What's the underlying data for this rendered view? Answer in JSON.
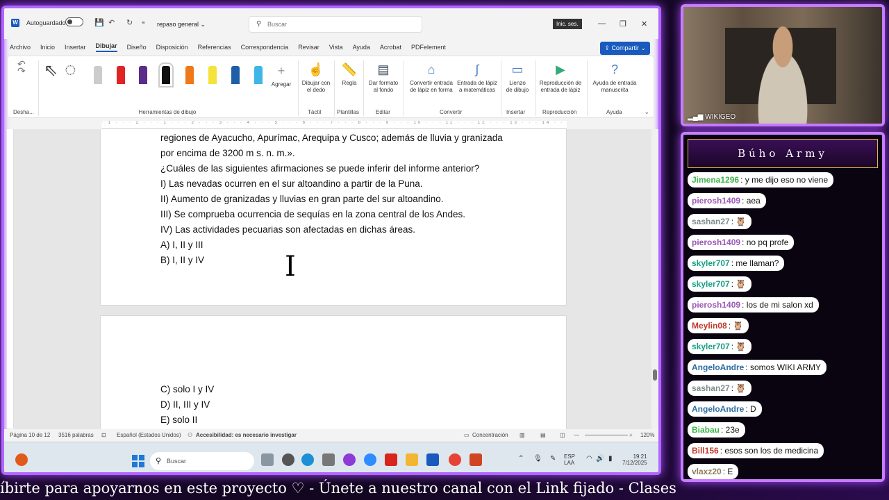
{
  "word": {
    "title_bar": {
      "app_icon": "W",
      "autosave_label": "Autoguardado",
      "doc_name": "repaso general",
      "search_placeholder": "Buscar",
      "signin_label": "Inic. ses."
    },
    "menu": [
      "Archivo",
      "Inicio",
      "Insertar",
      "Dibujar",
      "Diseño",
      "Disposición",
      "Referencias",
      "Correspondencia",
      "Revisar",
      "Vista",
      "Ayuda",
      "Acrobat",
      "PDFelement"
    ],
    "active_menu": "Dibujar",
    "share_label": "Compartir",
    "ribbon": {
      "undo_label": "Desha...",
      "group_drawing_tools": "Herramientas de dibujo",
      "add_label": "Agregar",
      "draw_finger_label": "Dibujar con\nel dedo",
      "group_tactil": "Táctil",
      "ruler_label": "Regla",
      "group_templates": "Plantillas",
      "format_bg_label": "Dar formato\nal fondo",
      "group_edit": "Editar",
      "convert_shape_label": "Convertir entrada\nde lápiz en forma",
      "math_label": "Entrada de lápiz\na matemáticas",
      "group_convert": "Convertir",
      "canvas_label": "Lienzo\nde dibujo",
      "group_insert": "Insertar",
      "replay_label": "Reproducción de\nentrada de lápiz",
      "group_replay": "Reproducción",
      "ink_help_label": "Ayuda de entrada\nmanuscrita",
      "group_help": "Ayuda"
    },
    "page1_lines": [
      "regiones de Ayacucho, Apurímac, Arequipa y Cusco; además de lluvia y granizada",
      "por encima de 3200 m s. n. m.».",
      "¿Cuáles de las siguientes afirmaciones se puede inferir del informe anterior?",
      "I) Las nevadas ocurren en el sur altoandino a partir de la Puna.",
      "II) Aumento de granizadas y lluvias en gran parte del sur altoandino.",
      "III) Se comprueba ocurrencia de sequías en la zona central de los Andes.",
      "IV) Las actividades pecuarias son afectadas en dichas áreas.",
      "A) I, II y III",
      "B) I, II y IV"
    ],
    "page2_lines": [
      "C) solo I y IV",
      "D) II, III y IV",
      "E) solo II"
    ],
    "status": {
      "page": "Página 10 de 12",
      "words": "3516 palabras",
      "language": "Español (Estados Unidos)",
      "accessibility": "Accesibilidad: es necesario investigar",
      "focus": "Concentración",
      "zoom": "120%"
    },
    "taskbar": {
      "search_placeholder": "Buscar",
      "lang_top": "ESP",
      "lang_bottom": "LAA",
      "time": "19:21",
      "date": "7/12/2025"
    }
  },
  "webcam": {
    "label": "WIKIGEO"
  },
  "chat": {
    "title": "Búho Army",
    "messages": [
      {
        "user": "Jimena1296",
        "color": "#3bb54a",
        "text": ": y me dijo eso no viene"
      },
      {
        "user": "pierosh1409",
        "color": "#9b59b6",
        "text": ": aea"
      },
      {
        "user": "sashan27",
        "color": "#7f8c8d",
        "text": ": 🦉"
      },
      {
        "user": "pierosh1409",
        "color": "#9b59b6",
        "text": ": no pq profe"
      },
      {
        "user": "skyler707",
        "color": "#16a085",
        "text": ": me llaman?"
      },
      {
        "user": "skyler707",
        "color": "#16a085",
        "text": ": 🦉"
      },
      {
        "user": "pierosh1409",
        "color": "#9b59b6",
        "text": ": los de mi salon xd"
      },
      {
        "user": "Meylin08",
        "color": "#c0392b",
        "text": ": 🦉"
      },
      {
        "user": "skyler707",
        "color": "#16a085",
        "text": ": 🦉"
      },
      {
        "user": "AngeloAndre",
        "color": "#2e6da4",
        "text": ": somos WIKI ARMY"
      },
      {
        "user": "sashan27",
        "color": "#7f8c8d",
        "text": ": 🦉"
      },
      {
        "user": "AngeloAndre",
        "color": "#2e6da4",
        "text": ": D"
      },
      {
        "user": "Biabau",
        "color": "#3bb54a",
        "text": ": 23e"
      },
      {
        "user": "Bill156",
        "color": "#c0392b",
        "text": ": esos son los de medicina"
      },
      {
        "user": "vlaxz20",
        "color": "#8e7f5a",
        "text": ": E"
      }
    ]
  },
  "ticker": {
    "text": "íbirte para apoyarnos en este proyecto ♡  -  Únete a nuestro canal con el Link fijado  -  Clases"
  },
  "colors": {
    "frame_neon": "#b066ff",
    "word_blue": "#185abd",
    "chat_title_border": "#e2b34a"
  }
}
